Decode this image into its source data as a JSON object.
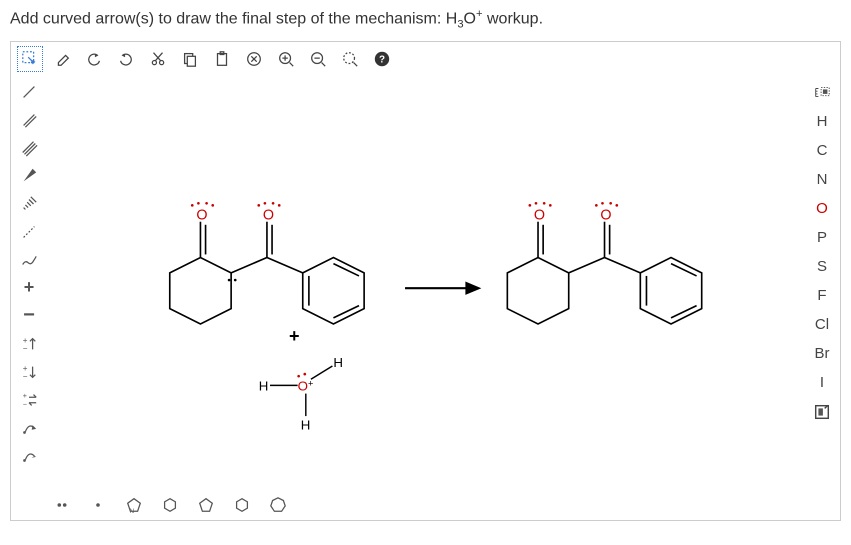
{
  "question": {
    "text_prefix": "Add curved arrow(s) to draw the final step of the mechanism: H",
    "sub": "3",
    "mid": "O",
    "sup": "+",
    "suffix": " workup."
  },
  "top_tools": [
    {
      "name": "select-rect-icon",
      "active": true
    },
    {
      "name": "eraser-icon"
    },
    {
      "name": "undo-icon"
    },
    {
      "name": "redo-icon"
    },
    {
      "name": "cut-icon"
    },
    {
      "name": "copy-icon"
    },
    {
      "name": "paste-icon"
    },
    {
      "name": "clear-icon"
    },
    {
      "name": "zoom-in-icon"
    },
    {
      "name": "zoom-out-icon"
    },
    {
      "name": "zoom-fit-icon"
    },
    {
      "name": "help-icon"
    }
  ],
  "left_tools": [
    {
      "name": "single-bond-tool",
      "glyph": "/"
    },
    {
      "name": "double-bond-tool",
      "glyph": "//"
    },
    {
      "name": "triple-bond-tool",
      "glyph": "///"
    },
    {
      "name": "wedge-bond-tool",
      "glyph": "◀"
    },
    {
      "name": "hash-bond-tool",
      "glyph": "┉"
    },
    {
      "name": "dashed-bond-tool",
      "glyph": "⟋"
    },
    {
      "name": "wavy-bond-tool",
      "glyph": "∿"
    },
    {
      "name": "plus-charge-tool",
      "glyph": "+"
    },
    {
      "name": "minus-charge-tool",
      "glyph": "−"
    },
    {
      "name": "increase-charge-tool",
      "glyph": "±↑"
    },
    {
      "name": "decrease-charge-tool",
      "glyph": "±↓"
    },
    {
      "name": "equilibrium-tool",
      "glyph": "⇄"
    },
    {
      "name": "curved-arrow-tool",
      "glyph": "↷"
    },
    {
      "name": "half-arrow-tool",
      "glyph": "↳"
    }
  ],
  "right_tools": [
    {
      "name": "stereo-tool-icon",
      "glyph": "▦"
    },
    {
      "name": "element-h",
      "glyph": "H"
    },
    {
      "name": "element-c",
      "glyph": "C"
    },
    {
      "name": "element-n",
      "glyph": "N"
    },
    {
      "name": "element-o",
      "glyph": "O",
      "cls": "o"
    },
    {
      "name": "element-p",
      "glyph": "P"
    },
    {
      "name": "element-s",
      "glyph": "S"
    },
    {
      "name": "element-f",
      "glyph": "F"
    },
    {
      "name": "element-cl",
      "glyph": "Cl"
    },
    {
      "name": "element-br",
      "glyph": "Br"
    },
    {
      "name": "element-i",
      "glyph": "I"
    },
    {
      "name": "periodic-table-icon",
      "glyph": "[▮"
    }
  ],
  "bottom_tools": [
    {
      "name": "lone-pair-icon"
    },
    {
      "name": "radical-icon"
    },
    {
      "name": "nitrogen-ring-icon"
    },
    {
      "name": "benzene-icon"
    },
    {
      "name": "cyclopentane-icon"
    },
    {
      "name": "cyclohexane-icon"
    },
    {
      "name": "cycloheptane-icon"
    }
  ],
  "canvas": {
    "plus_sign": "+",
    "reactant_labels": {
      "O": "O",
      "H": "H"
    },
    "hydronium": {
      "H": "H",
      "O_plus": "O+"
    },
    "product_labels": {
      "O": "O"
    }
  }
}
